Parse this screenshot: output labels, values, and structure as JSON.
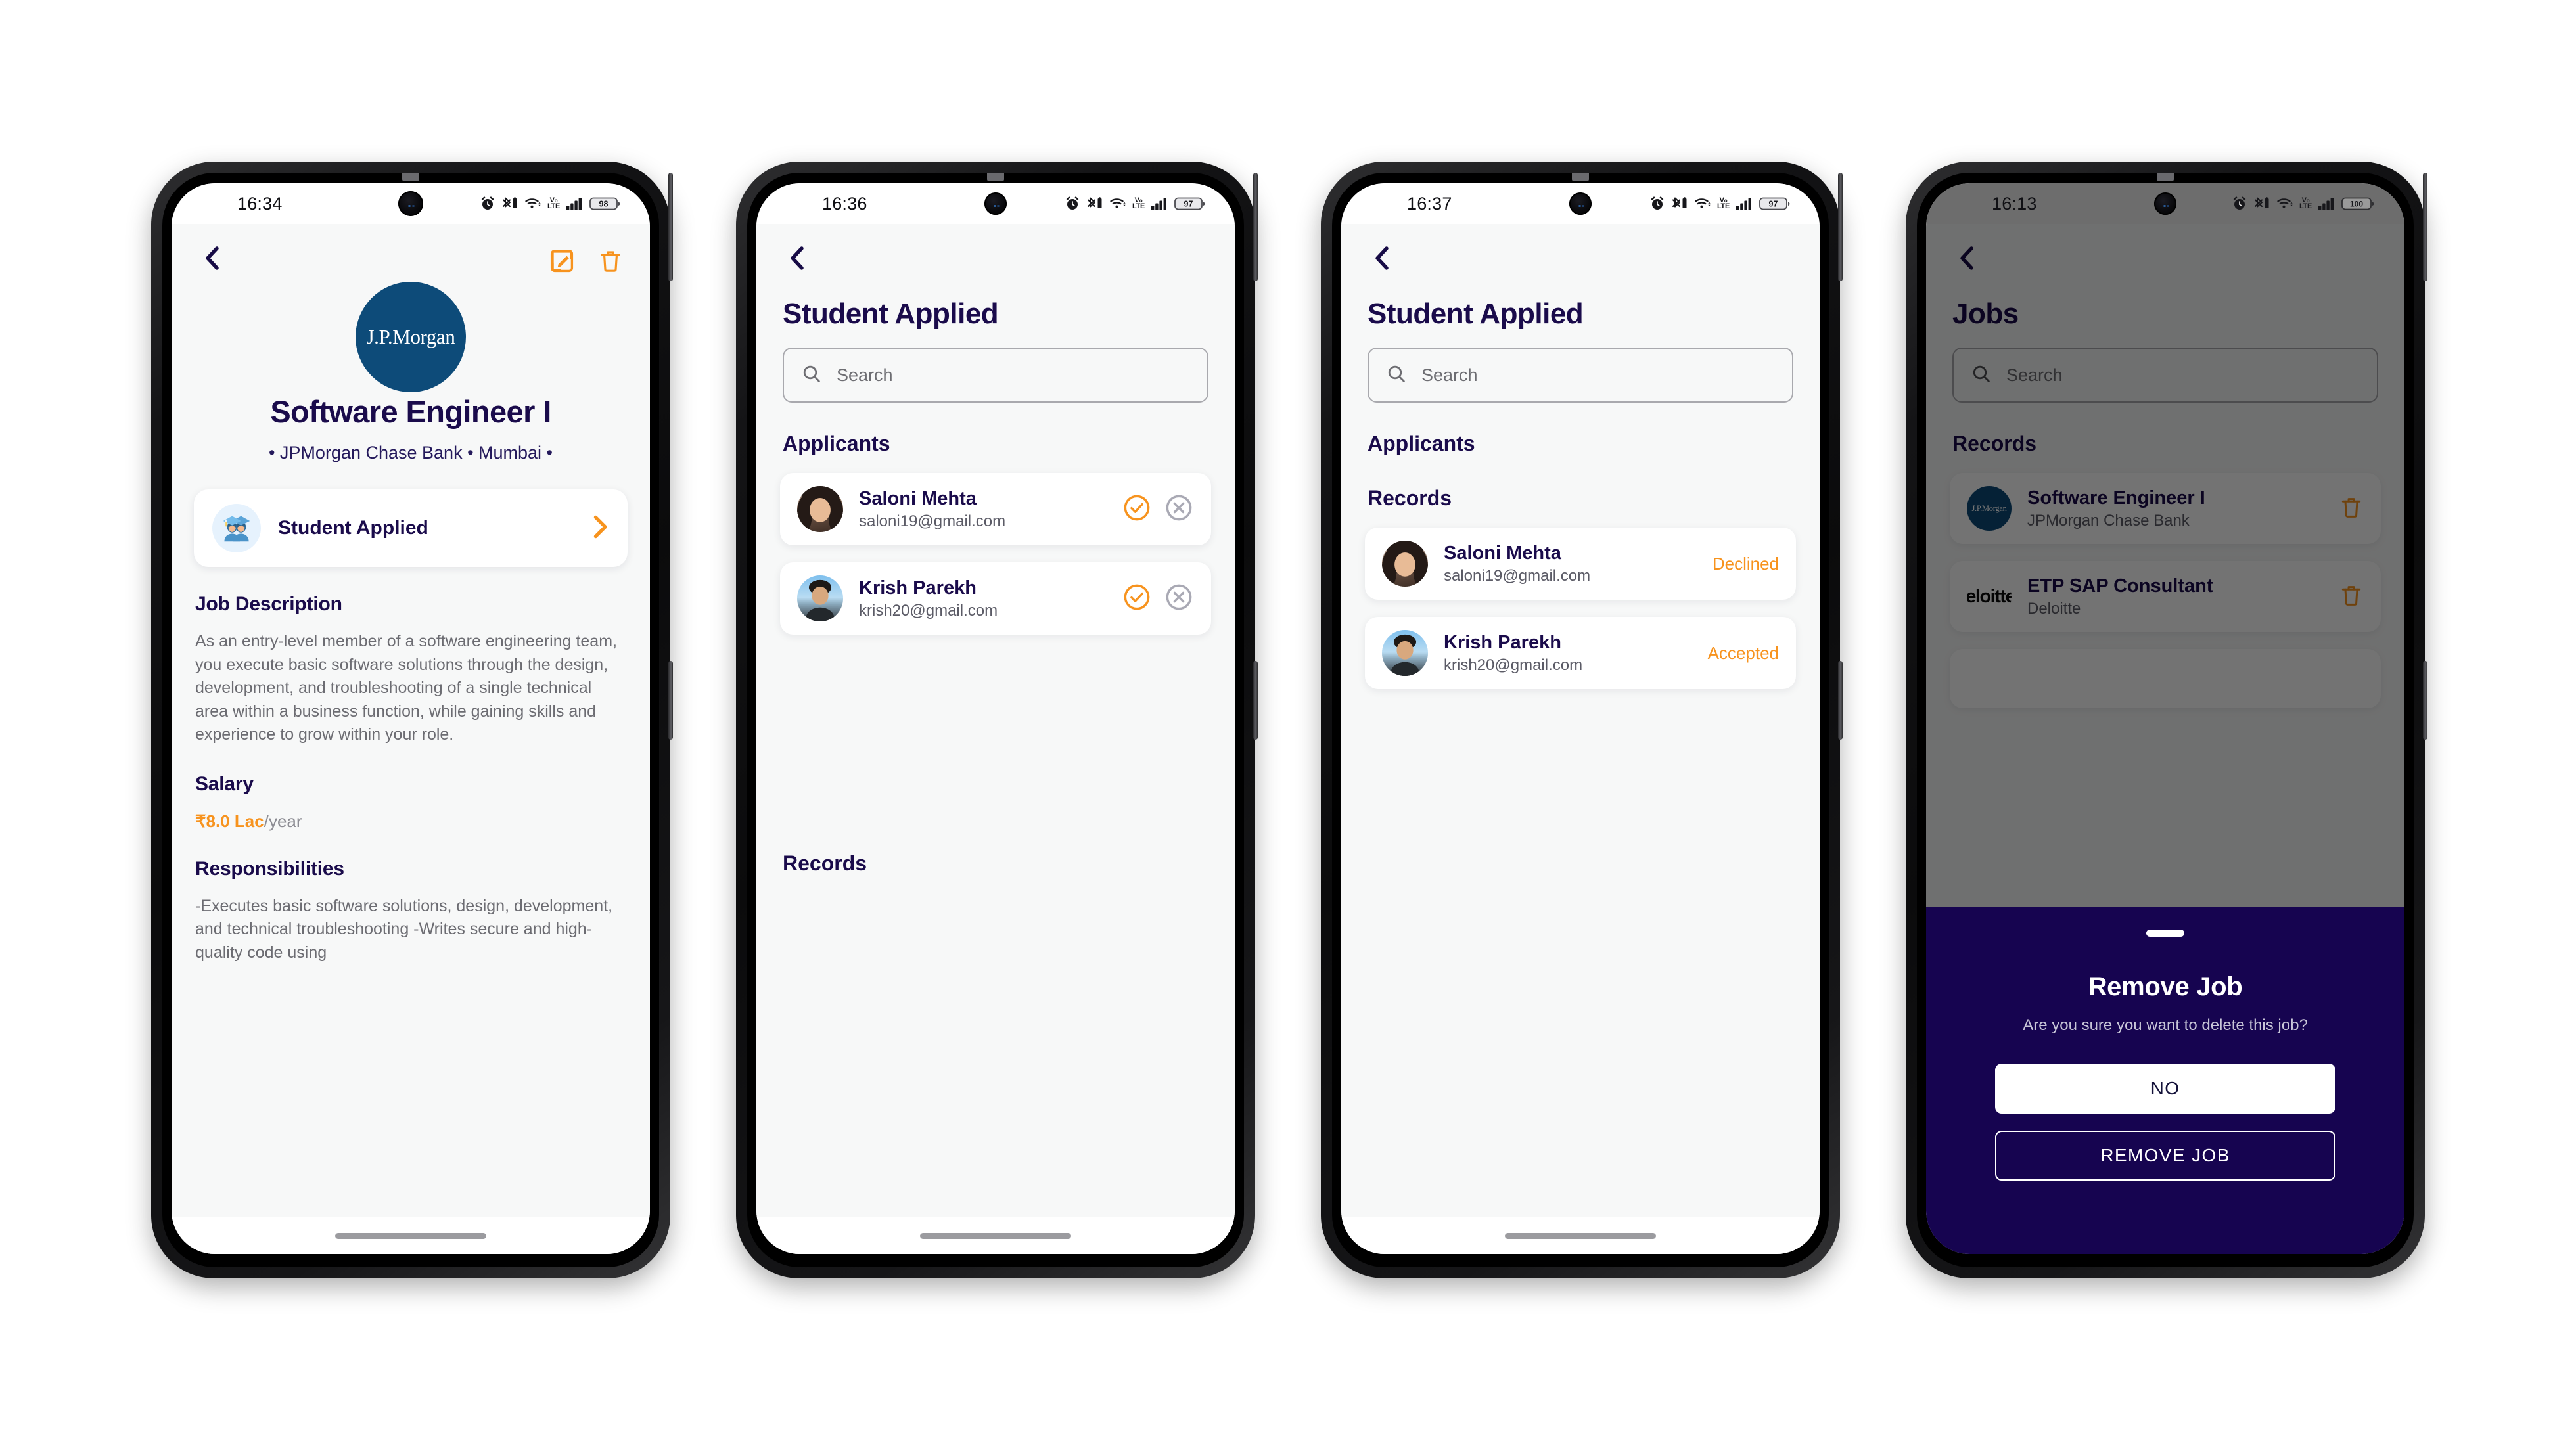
{
  "colors": {
    "navy": "#1a0b4b",
    "orange": "#f7931e",
    "grey": "#6d6d72",
    "jpmorgan_blue": "#0d4b79",
    "modal_bg": "#160450"
  },
  "phones": [
    {
      "status": {
        "time": "16:34",
        "battery": "98",
        "network": "VoLTE"
      },
      "screen": {
        "name": "job-detail",
        "logo_text": "J.P.Morgan",
        "job_title": "Software Engineer I",
        "job_subtitle": "• JPMorgan Chase Bank • Mumbai •",
        "applied_card_label": "Student Applied",
        "sections": [
          {
            "heading": "Job Description",
            "body": "As an entry-level member of a software engineering team, you execute basic software solutions through the design, development, and troubleshooting of a single technical area within a business function, while gaining skills and experience to grow within your role."
          }
        ],
        "salary_heading": "Salary",
        "salary_amount": "₹8.0 Lac",
        "salary_period": "/year",
        "responsibilities_heading": "Responsibilities",
        "responsibilities_body": "-Executes basic software solutions, design, development, and technical troubleshooting -Writes secure and high-quality code using"
      }
    },
    {
      "status": {
        "time": "16:36",
        "battery": "97",
        "network": "VoLTE"
      },
      "screen": {
        "name": "student-applied-list",
        "title": "Student Applied",
        "search_placeholder": "Search",
        "applicants_heading": "Applicants",
        "records_heading": "Records",
        "applicants": [
          {
            "name": "Saloni Mehta",
            "email": "saloni19@gmail.com",
            "avatar": "saloni"
          },
          {
            "name": "Krish Parekh",
            "email": "krish20@gmail.com",
            "avatar": "krish"
          }
        ]
      }
    },
    {
      "status": {
        "time": "16:37",
        "battery": "97",
        "network": "VoLTE"
      },
      "screen": {
        "name": "student-applied-records",
        "title": "Student Applied",
        "search_placeholder": "Search",
        "applicants_heading": "Applicants",
        "records_heading": "Records",
        "records": [
          {
            "name": "Saloni Mehta",
            "email": "saloni19@gmail.com",
            "status": "Declined",
            "avatar": "saloni"
          },
          {
            "name": "Krish Parekh",
            "email": "krish20@gmail.com",
            "status": "Accepted",
            "avatar": "krish"
          }
        ]
      }
    },
    {
      "status": {
        "time": "16:13",
        "battery": "100",
        "network": "VoLTE"
      },
      "screen": {
        "name": "jobs-with-remove-dialog",
        "title": "Jobs",
        "search_placeholder": "Search",
        "records_heading": "Records",
        "jobs": [
          {
            "title": "Software Engineer I",
            "company": "JPMorgan Chase Bank",
            "logo_text": "J.P.Morgan",
            "logo_kind": "jpm"
          },
          {
            "title": "ETP SAP Consultant",
            "company": "Deloitte",
            "logo_text": "Deloitte",
            "logo_kind": "dl"
          }
        ],
        "dialog": {
          "title": "Remove Job",
          "message": "Are you sure you want to delete this job?",
          "cancel_label": "NO",
          "confirm_label": "REMOVE JOB"
        }
      }
    }
  ]
}
